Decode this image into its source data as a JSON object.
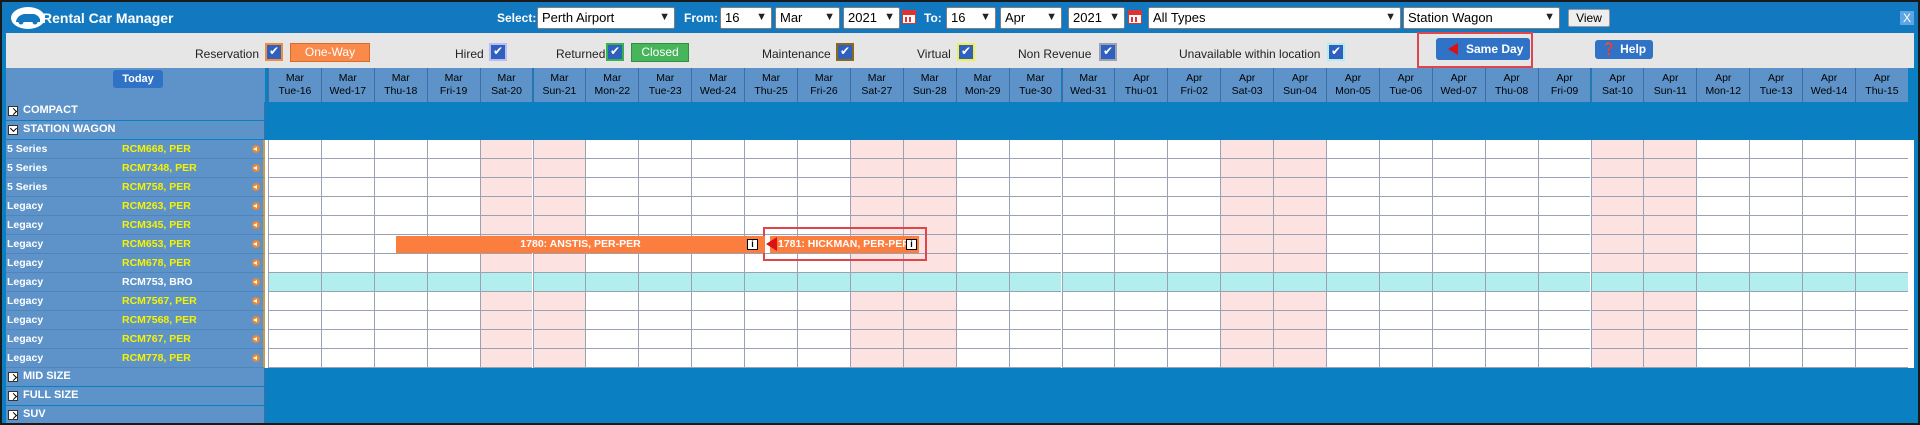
{
  "app": {
    "title": "Rental Car Manager"
  },
  "toolbar": {
    "select_label": "Select:",
    "location": "Perth Airport",
    "from_label": "From:",
    "from_day": "16",
    "from_month": "Mar",
    "from_year": "2021",
    "to_label": "To:",
    "to_day": "16",
    "to_month": "Apr",
    "to_year": "2021",
    "types": "All Types",
    "category": "Station Wagon",
    "view_label": "View",
    "close_label": "X"
  },
  "filters": {
    "reservation": "Reservation",
    "one_way": "One-Way",
    "hired": "Hired",
    "returned": "Returned",
    "closed": "Closed",
    "maintenance": "Maintenance",
    "virtual": "Virtual",
    "non_revenue": "Non Revenue",
    "unavailable": "Unavailable within location",
    "same_day": "Same Day",
    "help": "❓ Help"
  },
  "grid": {
    "today_label": "Today",
    "dates": [
      {
        "m": "Mar",
        "d": "Tue-16",
        "weekend": false
      },
      {
        "m": "Mar",
        "d": "Wed-17",
        "weekend": false
      },
      {
        "m": "Mar",
        "d": "Thu-18",
        "weekend": false
      },
      {
        "m": "Mar",
        "d": "Fri-19",
        "weekend": false
      },
      {
        "m": "Mar",
        "d": "Sat-20",
        "weekend": true
      },
      {
        "m": "Mar",
        "d": "Sun-21",
        "weekend": true
      },
      {
        "m": "Mar",
        "d": "Mon-22",
        "weekend": false
      },
      {
        "m": "Mar",
        "d": "Tue-23",
        "weekend": false
      },
      {
        "m": "Mar",
        "d": "Wed-24",
        "weekend": false
      },
      {
        "m": "Mar",
        "d": "Thu-25",
        "weekend": false
      },
      {
        "m": "Mar",
        "d": "Fri-26",
        "weekend": false
      },
      {
        "m": "Mar",
        "d": "Sat-27",
        "weekend": true
      },
      {
        "m": "Mar",
        "d": "Sun-28",
        "weekend": true
      },
      {
        "m": "Mar",
        "d": "Mon-29",
        "weekend": false
      },
      {
        "m": "Mar",
        "d": "Tue-30",
        "weekend": false
      },
      {
        "m": "Mar",
        "d": "Wed-31",
        "weekend": false
      },
      {
        "m": "Apr",
        "d": "Thu-01",
        "weekend": false
      },
      {
        "m": "Apr",
        "d": "Fri-02",
        "weekend": false
      },
      {
        "m": "Apr",
        "d": "Sat-03",
        "weekend": true
      },
      {
        "m": "Apr",
        "d": "Sun-04",
        "weekend": true
      },
      {
        "m": "Apr",
        "d": "Mon-05",
        "weekend": false
      },
      {
        "m": "Apr",
        "d": "Tue-06",
        "weekend": false
      },
      {
        "m": "Apr",
        "d": "Wed-07",
        "weekend": false
      },
      {
        "m": "Apr",
        "d": "Thu-08",
        "weekend": false
      },
      {
        "m": "Apr",
        "d": "Fri-09",
        "weekend": false
      },
      {
        "m": "Apr",
        "d": "Sat-10",
        "weekend": true
      },
      {
        "m": "Apr",
        "d": "Sun-11",
        "weekend": true
      },
      {
        "m": "Apr",
        "d": "Mon-12",
        "weekend": false
      },
      {
        "m": "Apr",
        "d": "Tue-13",
        "weekend": false
      },
      {
        "m": "Apr",
        "d": "Wed-14",
        "weekend": false
      },
      {
        "m": "Apr",
        "d": "Thu-15",
        "weekend": false
      }
    ],
    "categories_top": [
      "COMPACT",
      "STATION WAGON"
    ],
    "categories_bottom": [
      "MID SIZE",
      "FULL SIZE",
      "SUV"
    ],
    "vehicles": [
      {
        "model": "5 Series",
        "reg": "RCM668, PER",
        "other_location": false
      },
      {
        "model": "5 Series",
        "reg": "RCM7348, PER",
        "other_location": false
      },
      {
        "model": "5 Series",
        "reg": "RCM758, PER",
        "other_location": false
      },
      {
        "model": "Legacy",
        "reg": "RCM263, PER",
        "other_location": false
      },
      {
        "model": "Legacy",
        "reg": "RCM345, PER",
        "other_location": false
      },
      {
        "model": "Legacy",
        "reg": "RCM653, PER",
        "other_location": false
      },
      {
        "model": "Legacy",
        "reg": "RCM678, PER",
        "other_location": false
      },
      {
        "model": "Legacy",
        "reg": "RCM753, BRO",
        "other_location": true
      },
      {
        "model": "Legacy",
        "reg": "RCM7567, PER",
        "other_location": false
      },
      {
        "model": "Legacy",
        "reg": "RCM7568, PER",
        "other_location": false
      },
      {
        "model": "Legacy",
        "reg": "RCM767, PER",
        "other_location": false
      },
      {
        "model": "Legacy",
        "reg": "RCM778, PER",
        "other_location": false
      }
    ],
    "bookings": [
      {
        "label": "1780: ANSTIS, PER-PER",
        "info": "i"
      },
      {
        "label": "1781: HICKMAN, PER-PER",
        "info": "i"
      }
    ]
  },
  "colors": {
    "header_blue": "#1278bf",
    "weekend": "#fde2e2",
    "booking": "#fb7e3f",
    "highlight": "#e0454c",
    "other_location_row": "#b2eeee"
  }
}
